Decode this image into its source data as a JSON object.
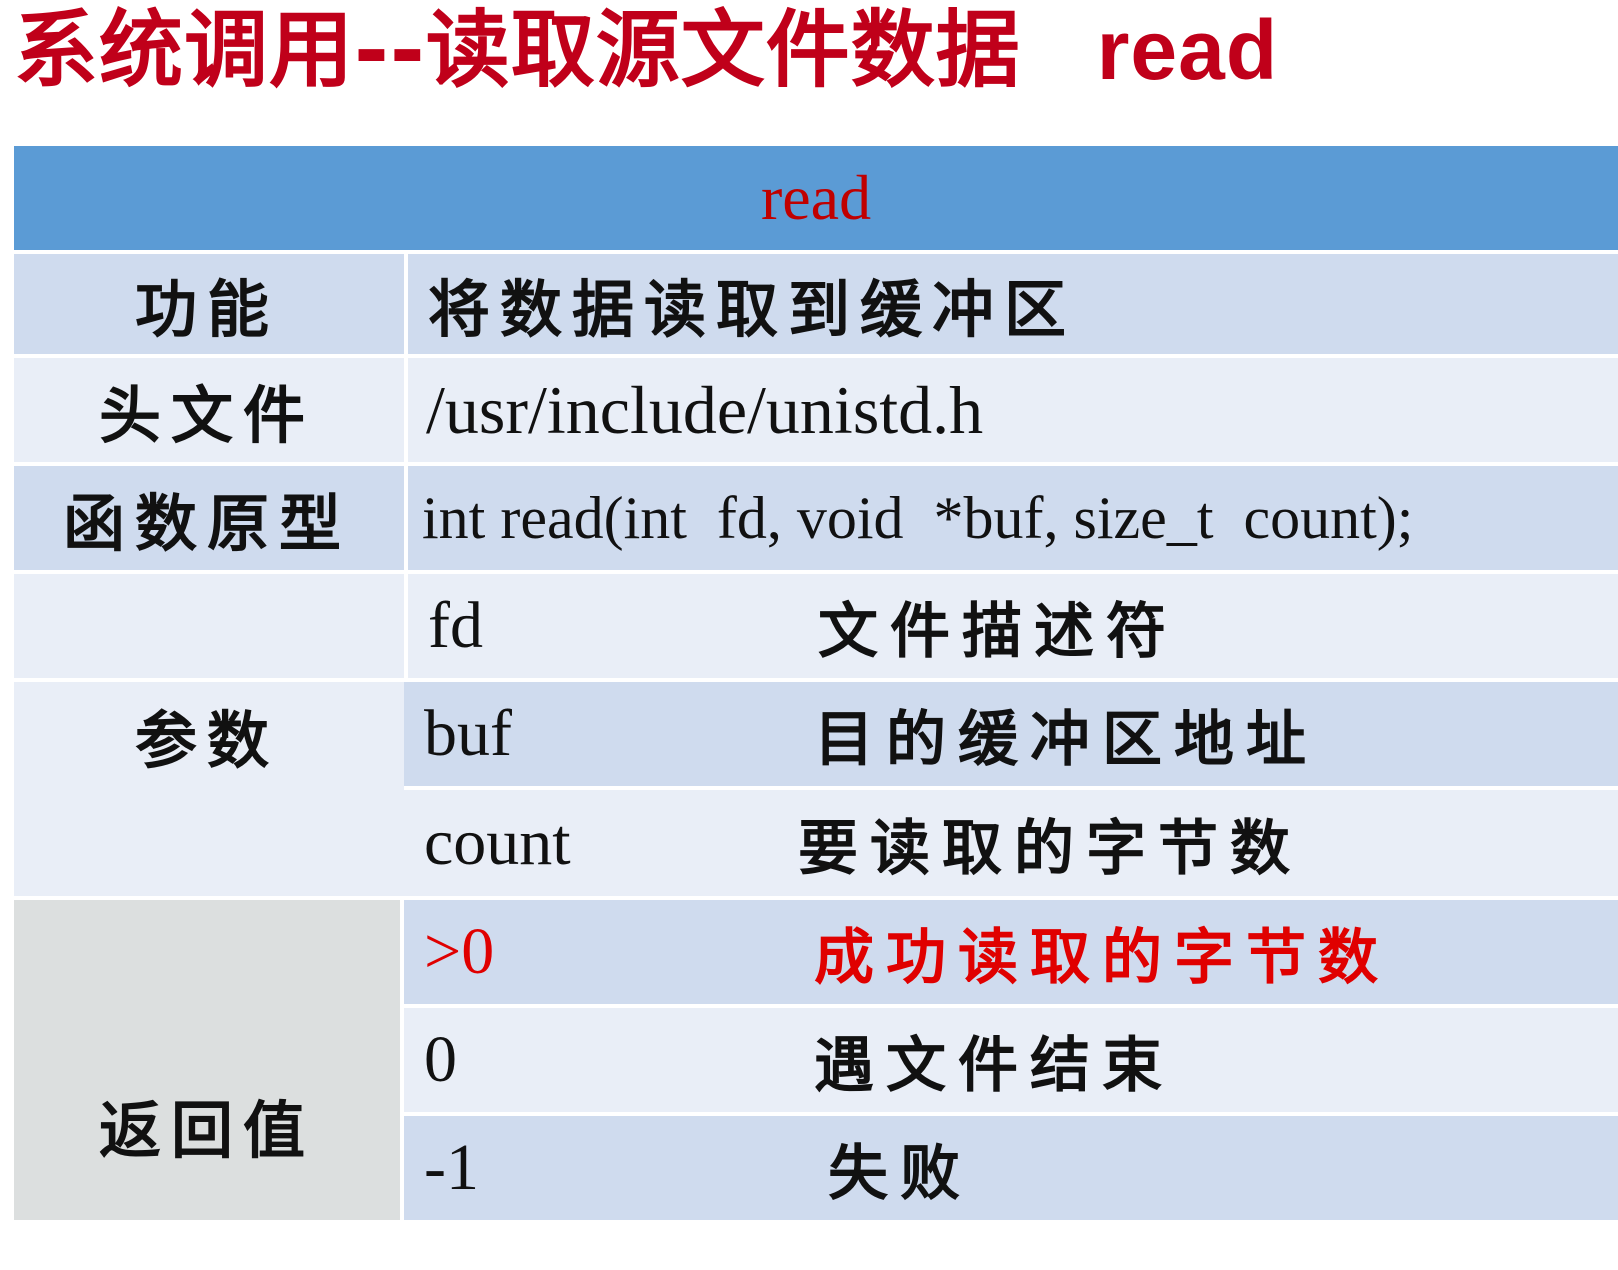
{
  "title": {
    "main": "系统调用--读取源文件数据",
    "function_name": "read"
  },
  "table": {
    "header": "read",
    "rows": {
      "function": {
        "label": "功能",
        "value": "将数据读取到缓冲区"
      },
      "header_file": {
        "label": "头文件",
        "value": "/usr/include/unistd.h"
      },
      "prototype": {
        "label": "函数原型",
        "value": "int read(int  fd, void  *buf, size_t  count);"
      },
      "params": {
        "label": "参数",
        "items": [
          {
            "name": "fd",
            "desc": "文件描述符"
          },
          {
            "name": "buf",
            "desc": "目的缓冲区地址"
          },
          {
            "name": "count",
            "desc": "要读取的字节数"
          }
        ]
      },
      "returns": {
        "label": "返回值",
        "items": [
          {
            "name": ">0",
            "desc": "成功读取的字节数"
          },
          {
            "name": "0",
            "desc": "遇文件结束"
          },
          {
            "name": "-1",
            "desc": "失败"
          }
        ]
      }
    },
    "highlight_color": "#e00000",
    "header_bg": "#5b9bd5"
  }
}
